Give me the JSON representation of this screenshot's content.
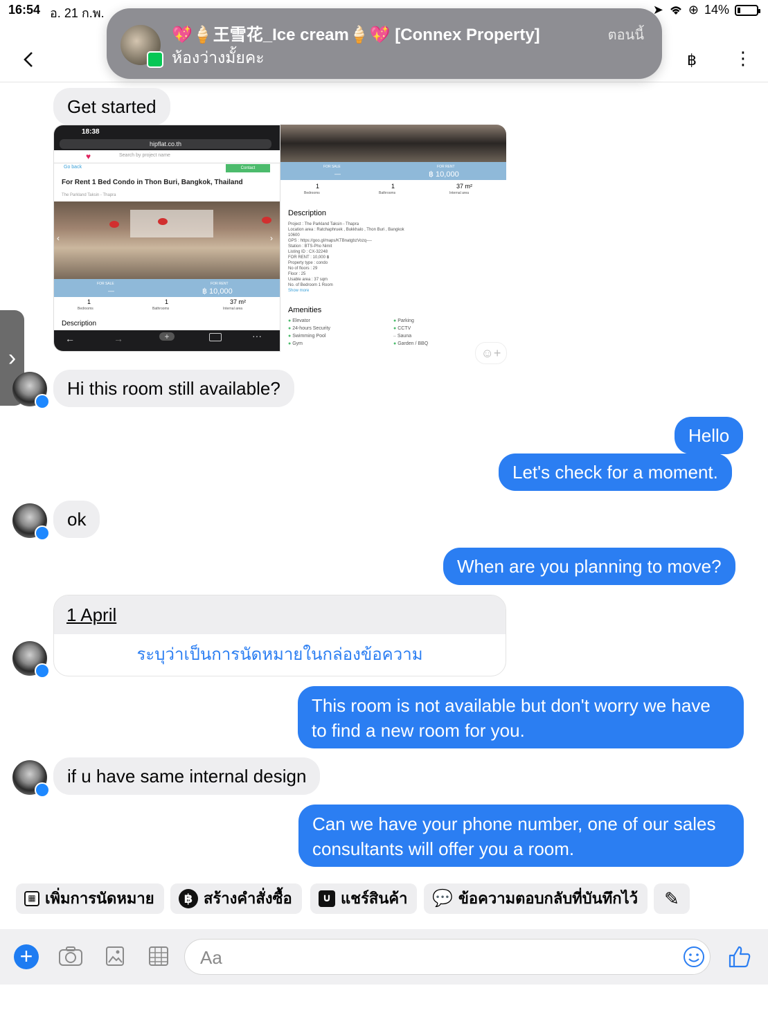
{
  "status_bar": {
    "time": "16:54",
    "date": "อ. 21 ก.พ.",
    "battery": "14%"
  },
  "notification": {
    "title": "💖🍦王雪花_Ice cream🍦💖 [Connex Property]",
    "message": "ห้องว่างมั้ยคะ",
    "when": "ตอนนี้"
  },
  "header": {
    "currency_icon": "฿",
    "more_icon": "⋮"
  },
  "messages": {
    "get_started": "Get started",
    "still_available": "Hi this room still available?",
    "hello": "Hello",
    "check_moment": "Let's check for a moment.",
    "ok": "ok",
    "when_move": "When are you planning to move?",
    "date_text": "1 April",
    "date_action": "ระบุว่าเป็นการนัดหมายในกล่องข้อความ",
    "not_available_1": "This room is not available but don't worry we have",
    "not_available_2": "to find a new room for you.",
    "same_design": "if u have same internal design",
    "phone_1": "Can we have your phone number, one of our sales",
    "phone_2": "consultants will offer you a room."
  },
  "listing": {
    "phone_time": "18:38",
    "url": "hipflat.co.th",
    "search_placeholder": "Search by project name",
    "go_back": "Go back",
    "contact": "Contact",
    "title": "For Rent 1 Bed Condo in Thon Buri, Bangkok, Thailand",
    "location": "The Parkland Taksin - Thapra",
    "for_sale_label": "FOR SALE",
    "for_sale_value": "—",
    "for_rent_label": "FOR RENT",
    "for_rent_value": "฿ 10,000",
    "bedrooms": "1",
    "bedrooms_label": "Bedrooms",
    "bathrooms": "1",
    "bathrooms_label": "Bathrooms",
    "area": "37 m²",
    "area_label": "Internal area",
    "description_heading": "Description",
    "description_lines": [
      "Project : The Parkland Taksin - Thapra",
      "Location area : Ratchaphruek , Bukkhalo , Thon Buri , Bangkok",
      "10600",
      "GPS : https://goo.gl/maps/KTBnatgbzVozq----",
      "Station : BTS-Pho Nimit",
      "Listing ID : CX-32248",
      "FOR RENT : 10,000 ฿",
      "Property type : condo",
      "No of floors : 29",
      "Floor : 25",
      "Usable area : 37 sqm",
      "No. of Bedroom 1 Room"
    ],
    "show_more": "Show more",
    "amenities_heading": "Amenities",
    "amenities_left": [
      "Elevator",
      "24-hours Security",
      "Swimming Pool",
      "Gym"
    ],
    "amenities_right": [
      "Parking",
      "CCTV",
      "Sauna",
      "Garden / BBQ"
    ]
  },
  "quick_actions": {
    "add_appointment": "เพิ่มการนัดหมาย",
    "create_order": "สร้างคำสั่งซื้อ",
    "share_product": "แชร์สินค้า",
    "saved_replies": "ข้อความตอบกลับที่บันทึกไว้"
  },
  "composer": {
    "placeholder": "Aa"
  },
  "colors": {
    "accent": "#2b7ef2",
    "incoming_bubble": "#eeeef0",
    "banner": "#8e8e93"
  }
}
